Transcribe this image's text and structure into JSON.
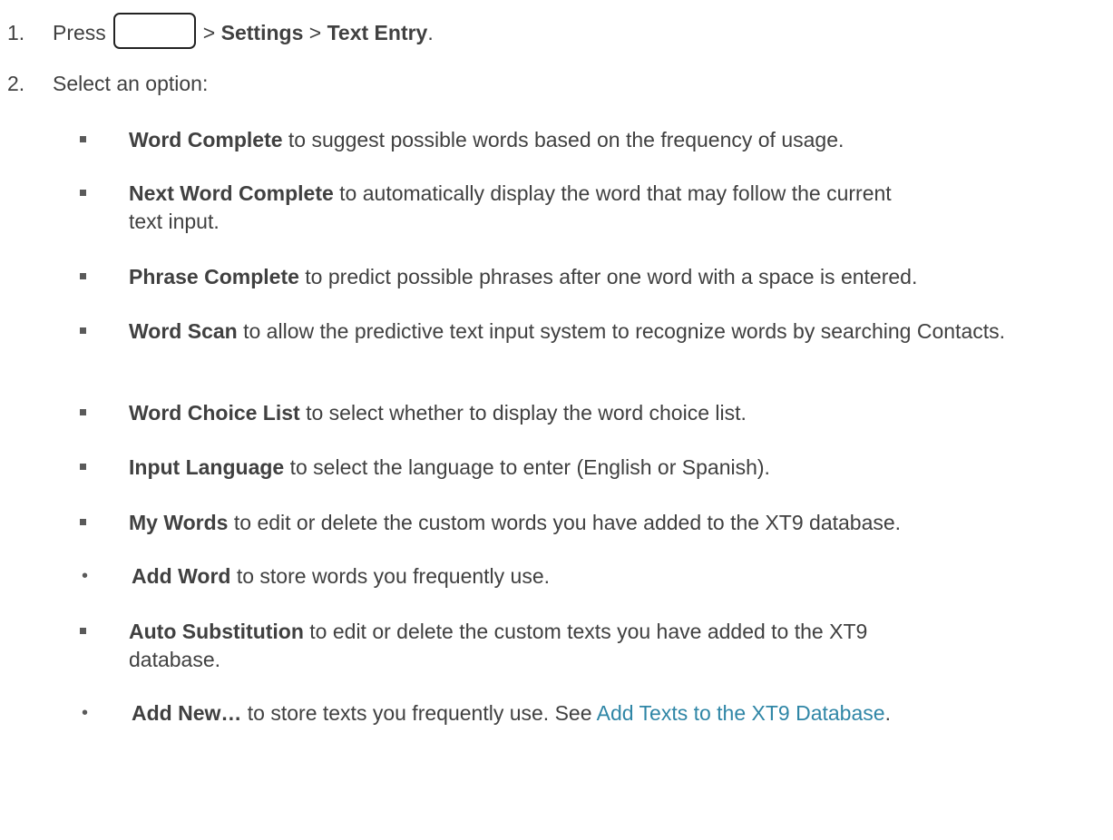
{
  "step1": {
    "number": "1.",
    "press": "Press",
    "sep1": ">",
    "settings": "Settings",
    "sep2": ">",
    "text_entry": "Text Entry",
    "end": "."
  },
  "step2": {
    "number": "2.",
    "text": "Select an option:"
  },
  "options": [
    {
      "title": "Word Complete",
      "desc": "to suggest possible words based on the frequency of usage."
    },
    {
      "title": "Next Word Complete",
      "desc": "to automatically display the word that may follow the current text input."
    },
    {
      "title": "Phrase Complete",
      "desc": "to predict possible phrases after one word with a space is entered."
    },
    {
      "title": "Word Scan",
      "desc": "to allow the predictive text input system to recognize words by searching Contacts."
    },
    {
      "title": "Word Choice List",
      "desc": "to select whether to display the word choice list."
    },
    {
      "title": "Input Language",
      "desc": "to select the language to enter (English or Spanish)."
    },
    {
      "title": "My Words",
      "desc": "to edit or delete the custom words you have added to the XT9 database."
    },
    {
      "title": "Add Word",
      "desc": "to store words you frequently use."
    },
    {
      "title": "Auto Substitution",
      "desc": "to edit or delete the custom texts you have added to the XT9 database."
    },
    {
      "title": "Add New…",
      "desc": "to store texts you frequently use. See",
      "link": "Add Texts to the XT9 Database",
      "end": "."
    }
  ],
  "bullets": {
    "square": "■",
    "dot": "•"
  }
}
